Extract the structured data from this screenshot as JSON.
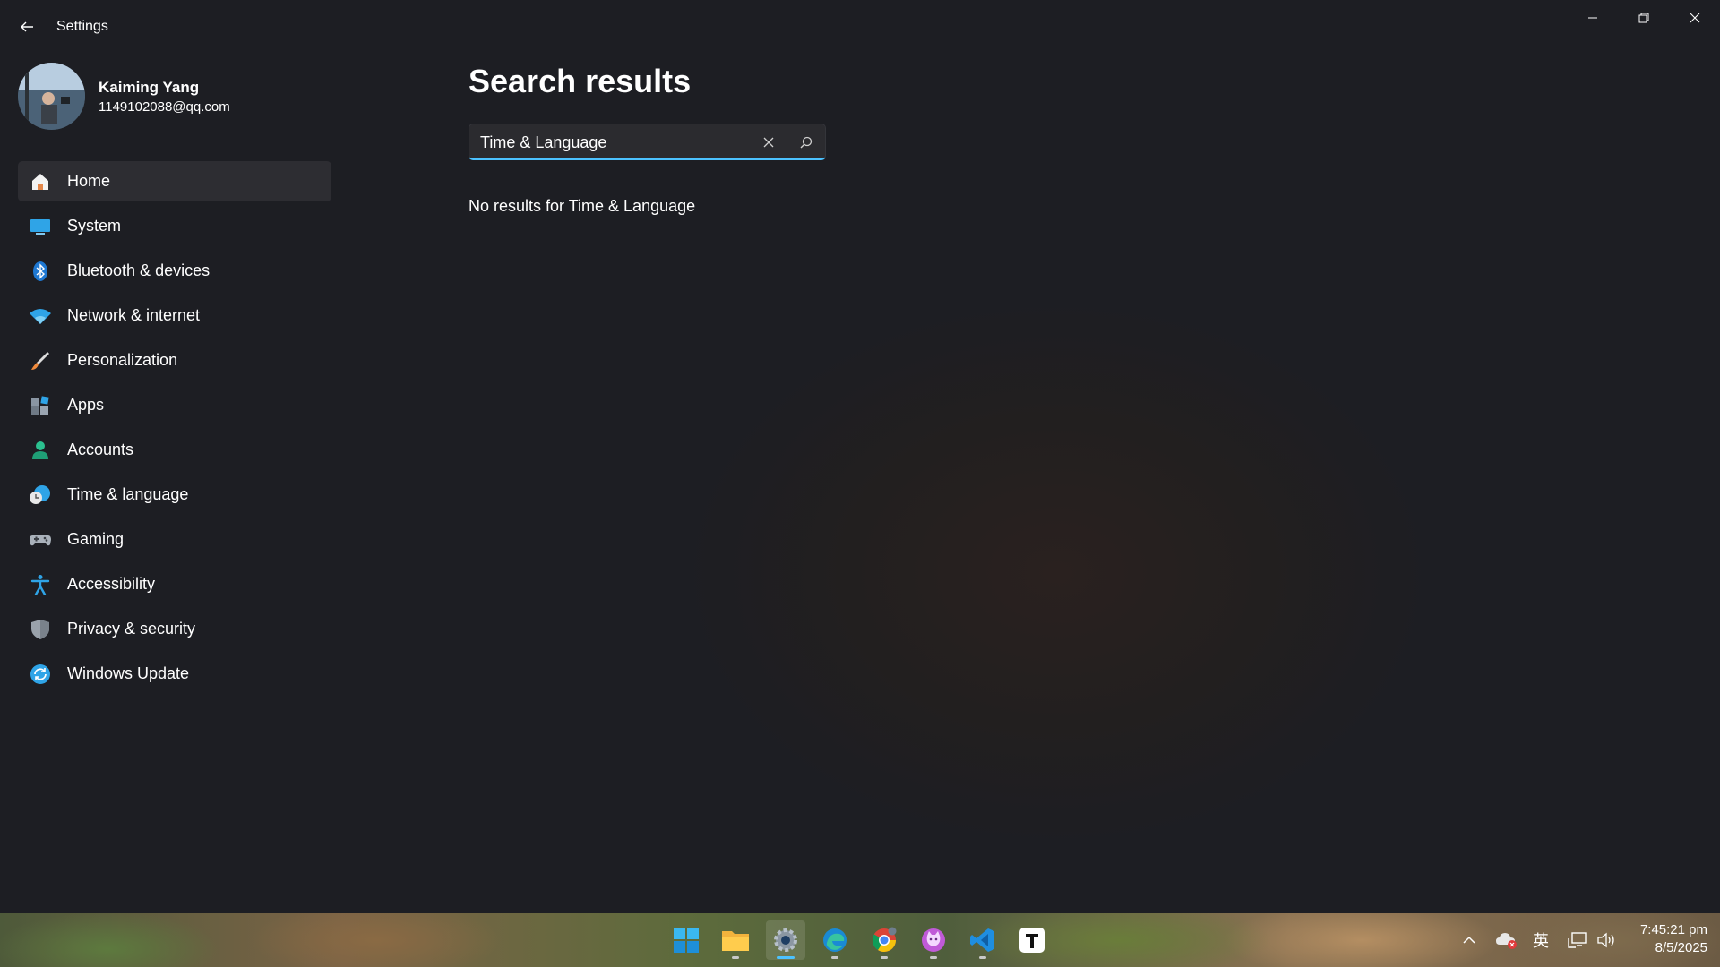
{
  "window": {
    "title": "Settings"
  },
  "profile": {
    "name": "Kaiming Yang",
    "email": "1149102088@qq.com"
  },
  "nav": {
    "items": [
      {
        "label": "Home",
        "icon": "home-icon",
        "active": true
      },
      {
        "label": "System",
        "icon": "monitor-icon"
      },
      {
        "label": "Bluetooth & devices",
        "icon": "bluetooth-icon"
      },
      {
        "label": "Network & internet",
        "icon": "wifi-icon"
      },
      {
        "label": "Personalization",
        "icon": "brush-icon"
      },
      {
        "label": "Apps",
        "icon": "apps-icon"
      },
      {
        "label": "Accounts",
        "icon": "person-icon"
      },
      {
        "label": "Time & language",
        "icon": "globe-clock-icon"
      },
      {
        "label": "Gaming",
        "icon": "gamepad-icon"
      },
      {
        "label": "Accessibility",
        "icon": "accessibility-icon"
      },
      {
        "label": "Privacy & security",
        "icon": "shield-icon"
      },
      {
        "label": "Windows Update",
        "icon": "refresh-icon"
      }
    ]
  },
  "main": {
    "title": "Search results",
    "search": {
      "value": "Time & Language"
    },
    "message": "No results for Time & Language"
  },
  "taskbar": {
    "apps": [
      "start-icon",
      "file-explorer-icon",
      "settings-icon",
      "edge-icon",
      "chrome-icon",
      "cat-app-icon",
      "vscode-icon",
      "typora-icon"
    ],
    "tray": {
      "ime": "英"
    },
    "clock": {
      "time": "7:45:21 pm",
      "date": "8/5/2025"
    }
  },
  "colors": {
    "accent": "#4cc2ff",
    "background": "#1e1f24",
    "active_nav": "#2d2d32"
  }
}
